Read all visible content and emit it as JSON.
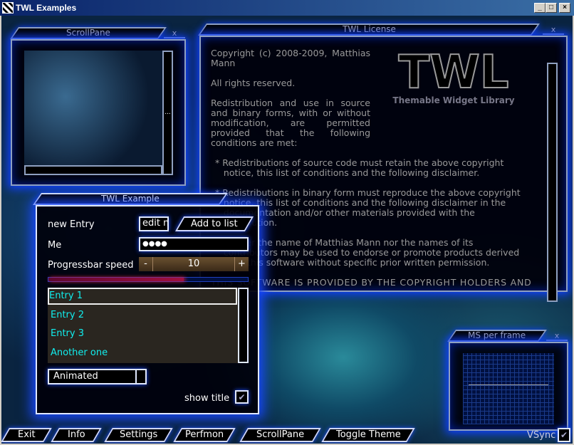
{
  "window": {
    "title": "TWL Examples",
    "minimize": "_",
    "maximize": "□",
    "close": "×"
  },
  "scrollpane": {
    "title": "ScrollPane",
    "close": "x",
    "grip": "..."
  },
  "license": {
    "title": "TWL License",
    "close": "x",
    "logo": "TWL",
    "logo_sub": "Themable Widget Library",
    "para1": "Copyright (c) 2008-2009, Matthias Mann",
    "para2": "All rights reserved.",
    "para3": "Redistribution and use in source and binary forms, with or without modification, are permitted provided that the following conditions are met:",
    "bullets": [
      "* Redistributions of source code must retain the above copyright\n   notice, this list of conditions and the following disclaimer.",
      "* Redistributions in binary form must reproduce the above copyright\n   notice, this list of conditions and the following disclaimer in the\n   documentation and/or other materials provided with the\n   distribution.",
      "* Neither the name of Matthias Mann nor the names of its\n   contributors may be used to endorse or promote products derived\n   from this software without specific prior written permission."
    ],
    "last": "THIS SOFTWARE IS PROVIDED BY THE COPYRIGHT HOLDERS AND"
  },
  "example": {
    "title": "TWL Example",
    "new_entry_label": "new Entry",
    "new_entry_value": "edit me",
    "add_button": "Add to list",
    "me_label": "Me",
    "me_value": "●●●●",
    "speed_label": "Progressbar speed",
    "speed_minus": "-",
    "speed_value": "10",
    "speed_plus": "+",
    "progress": 0.68,
    "list": [
      "Entry 1",
      "Entry 2",
      "Entry 3",
      "Another one"
    ],
    "selected": "Entry 1",
    "combo_value": "Animated",
    "show_title_label": "show title",
    "show_title_checked": true,
    "check": "✔"
  },
  "perf": {
    "title": "MS per frame",
    "close": "x"
  },
  "bottom": {
    "buttons": [
      "Exit",
      "Info",
      "Settings",
      "Perfmon",
      "ScrollPane",
      "Toggle Theme"
    ],
    "vsync_label": "VSync",
    "vsync_checked": true,
    "check": "✔"
  },
  "colors": {
    "accent": "#1040ff",
    "list_text": "#11eeee",
    "progress_fill": "#8a1040"
  }
}
